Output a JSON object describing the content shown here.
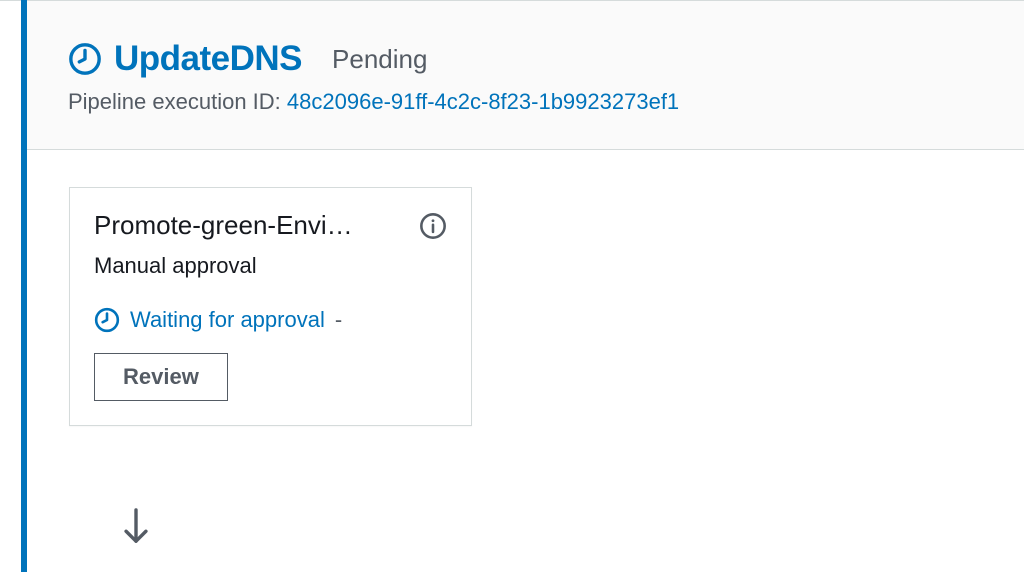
{
  "stage": {
    "name": "UpdateDNS",
    "status": "Pending",
    "exec_id_label": "Pipeline execution ID:",
    "exec_id_value": "48c2096e-91ff-4c2c-8f23-1b9923273ef1"
  },
  "action": {
    "title": "Promote-green-Envi…",
    "subtitle": "Manual approval",
    "status_text": "Waiting for approval",
    "status_dash": "-",
    "review_label": "Review"
  }
}
